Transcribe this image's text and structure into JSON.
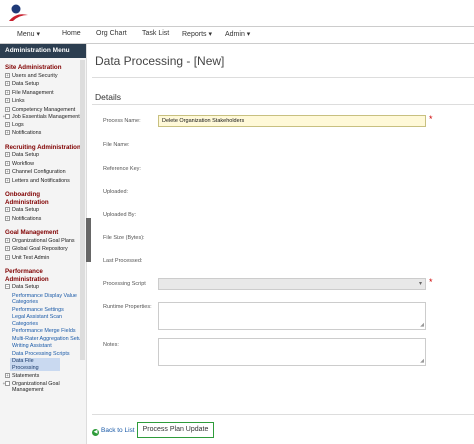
{
  "nav": {
    "menu": "Menu ▾",
    "home": "Home",
    "org_chart": "Org Chart",
    "task_list": "Task List",
    "reports": "Reports ▾",
    "admin": "Admin ▾"
  },
  "sidebar": {
    "header": "Administration Menu",
    "sections": {
      "site_admin": "Site Administration",
      "recruiting": "Recruiting Administration",
      "onboarding": "Onboarding Administration",
      "goal_mgmt": "Goal Management",
      "performance": "Performance Administration"
    },
    "site_admin_items": [
      "Users and Security",
      "Data Setup",
      "File Management",
      "Links",
      "Competency Management",
      "Job Essentials Management",
      "Logs",
      "Notifications"
    ],
    "recruiting_items": [
      "Data Setup",
      "Workflow",
      "Channel Configuration",
      "Letters and Notifications"
    ],
    "onboarding_items": [
      "Data Setup",
      "Notifications"
    ],
    "goal_items": [
      "Organizational Goal Plans",
      "Global Goal Repository",
      "Unit Test Admin"
    ],
    "performance_items": {
      "data_setup": "Data Setup",
      "subs": [
        "Performance Display Value Categories",
        "Performance Settings",
        "Legal Assistant Scan Categories",
        "Performance Merge Fields",
        "Multi-Rater Aggregation Setup",
        "Writing Assistant",
        "Data Processing Scripts",
        "Data File Processing"
      ],
      "statements": "Statements",
      "org_goal_mgmt": "Organizational Goal Management"
    }
  },
  "main": {
    "title": "Data Processing - [New]",
    "details_heading": "Details",
    "labels": {
      "process_name": "Process Name:",
      "file_name": "File Name:",
      "reference_key": "Reference Key:",
      "uploaded": "Uploaded:",
      "uploaded_by": "Uploaded By:",
      "file_size": "File Size (Bytes):",
      "last_processed": "Last Processed:",
      "processing_script": "Processing Script",
      "runtime_properties": "Runtime Properties:",
      "notes": "Notes:"
    },
    "process_name_value": "Delete Organization Stakeholders",
    "processing_script_value": "",
    "required_mark": "*",
    "back_link": "Back to List",
    "update_button": "Process Plan Update"
  },
  "colors": {
    "sidebar_header_bg": "#2c3e50",
    "section_heading": "#800000",
    "link": "#1a5aa8",
    "required": "#cc0000",
    "highlight_field": "#fff9d8",
    "accent_green": "#2e9c3a"
  }
}
